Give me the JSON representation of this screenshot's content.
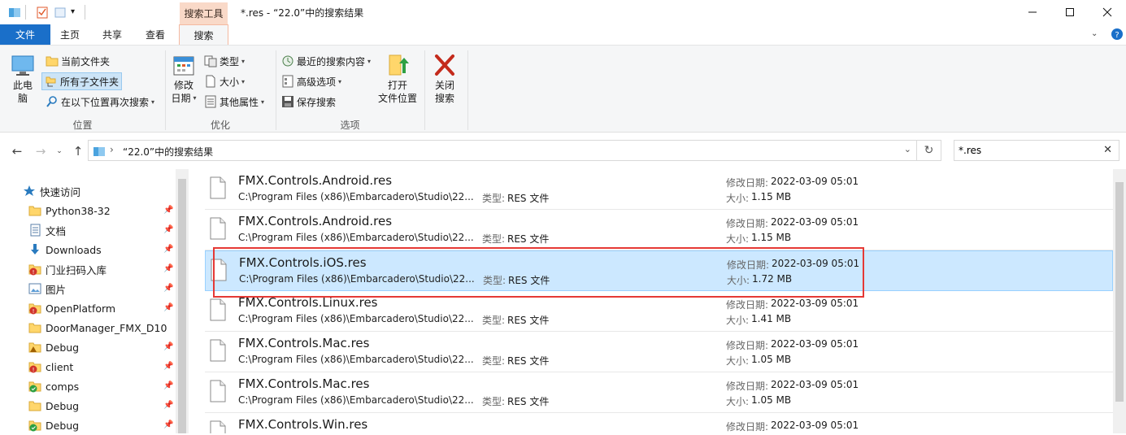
{
  "window": {
    "title": "*.res - “22.0”中的搜索结果",
    "context_tab": "搜索工具",
    "minimize_icon": "minimize-icon",
    "maximize_icon": "maximize-icon",
    "close_icon": "close-icon"
  },
  "tabs": [
    {
      "label": "文件"
    },
    {
      "label": "主页"
    },
    {
      "label": "共享"
    },
    {
      "label": "查看"
    },
    {
      "label": "搜索"
    }
  ],
  "ribbon": {
    "this_pc": [
      "此电",
      "脑"
    ],
    "current_folder": "当前文件夹",
    "all_subfolders": "所有子文件夹",
    "search_again_in": "在以下位置再次搜索",
    "location_group": "位置",
    "date_modified": [
      "修改",
      "日期"
    ],
    "kind": "类型",
    "size": "大小",
    "other_properties": "其他属性",
    "refine_group": "优化",
    "recent_searches": "最近的搜索内容",
    "advanced_options": "高级选项",
    "save_search": "保存搜索",
    "options_group": "选项",
    "open_location": [
      "打开",
      "文件位置"
    ],
    "close_search": [
      "关闭",
      "搜索"
    ],
    "colors": {
      "accent": "#1a6fc9",
      "context_tab": "#f9d9c8",
      "close_red": "#c42b1c"
    }
  },
  "address": {
    "breadcrumb": "“22.0”中的搜索结果",
    "search_value": "*.res"
  },
  "navpane": {
    "items": [
      {
        "label": "快速访问",
        "icon": "star-icon",
        "pinned": false
      },
      {
        "label": "Python38-32",
        "icon": "folder-icon",
        "pinned": true
      },
      {
        "label": "文档",
        "icon": "documents-icon",
        "pinned": true
      },
      {
        "label": "Downloads",
        "icon": "download-icon",
        "pinned": true
      },
      {
        "label": "门业扫码入库",
        "icon": "folder-error-icon",
        "pinned": true
      },
      {
        "label": "图片",
        "icon": "pictures-icon",
        "pinned": true
      },
      {
        "label": "OpenPlatform",
        "icon": "folder-error-icon",
        "pinned": true
      },
      {
        "label": "DoorManager_FMX_D10",
        "icon": "folder-icon",
        "pinned": false
      },
      {
        "label": "Debug",
        "icon": "folder-warning-icon",
        "pinned": true
      },
      {
        "label": "client",
        "icon": "folder-error-icon",
        "pinned": true
      },
      {
        "label": "comps",
        "icon": "folder-ok-icon",
        "pinned": true
      },
      {
        "label": "Debug",
        "icon": "folder-icon",
        "pinned": true
      },
      {
        "label": "Debug",
        "icon": "folder-ok-icon",
        "pinned": true
      }
    ]
  },
  "results": {
    "type_label": "类型:",
    "date_label": "修改日期:",
    "size_label": "大小:",
    "rows": [
      {
        "name": "FMX.Controls.Android.res",
        "path": "C:\\Program Files (x86)\\Embarcadero\\Studio\\22....",
        "type": "RES 文件",
        "date": "2022-03-09 05:01",
        "size": "1.15 MB",
        "selected": false
      },
      {
        "name": "FMX.Controls.Android.res",
        "path": "C:\\Program Files (x86)\\Embarcadero\\Studio\\22....",
        "type": "RES 文件",
        "date": "2022-03-09 05:01",
        "size": "1.15 MB",
        "selected": false
      },
      {
        "name": "FMX.Controls.iOS.res",
        "path": "C:\\Program Files (x86)\\Embarcadero\\Studio\\22....",
        "type": "RES 文件",
        "date": "2022-03-09 05:01",
        "size": "1.72 MB",
        "selected": true
      },
      {
        "name": "FMX.Controls.Linux.res",
        "path": "C:\\Program Files (x86)\\Embarcadero\\Studio\\22....",
        "type": "RES 文件",
        "date": "2022-03-09 05:01",
        "size": "1.41 MB",
        "selected": false
      },
      {
        "name": "FMX.Controls.Mac.res",
        "path": "C:\\Program Files (x86)\\Embarcadero\\Studio\\22....",
        "type": "RES 文件",
        "date": "2022-03-09 05:01",
        "size": "1.05 MB",
        "selected": false
      },
      {
        "name": "FMX.Controls.Mac.res",
        "path": "C:\\Program Files (x86)\\Embarcadero\\Studio\\22....",
        "type": "RES 文件",
        "date": "2022-03-09 05:01",
        "size": "1.05 MB",
        "selected": false
      },
      {
        "name": "FMX.Controls.Win.res",
        "path": "",
        "type": "",
        "date": "2022-03-09 05:01",
        "size": "",
        "selected": false
      }
    ]
  }
}
